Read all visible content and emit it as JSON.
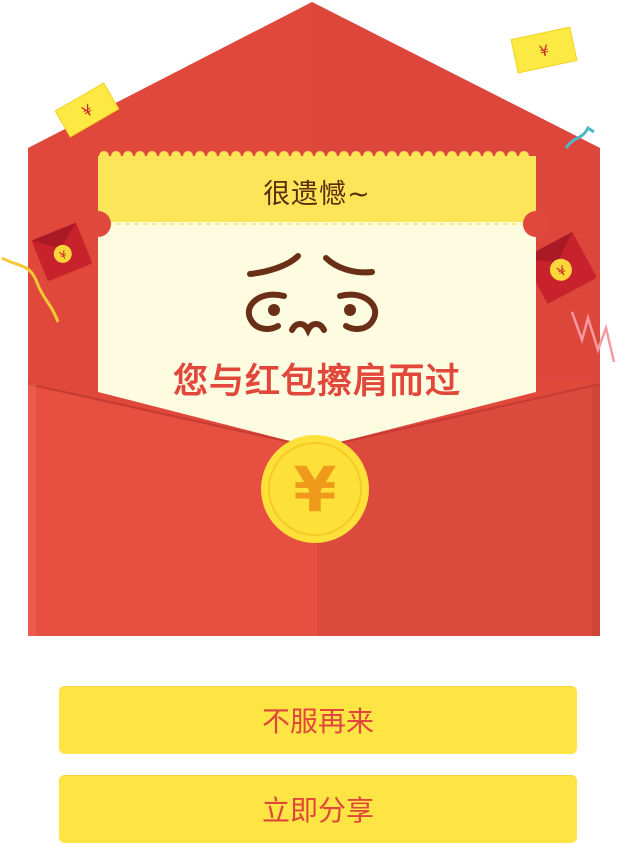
{
  "envelope": {
    "title": "很遗憾~",
    "message": "您与红包擦肩而过",
    "coin_symbol": "¥",
    "ticket_symbol": "¥"
  },
  "actions": {
    "retry_label": "不服再来",
    "share_label": "立即分享"
  }
}
